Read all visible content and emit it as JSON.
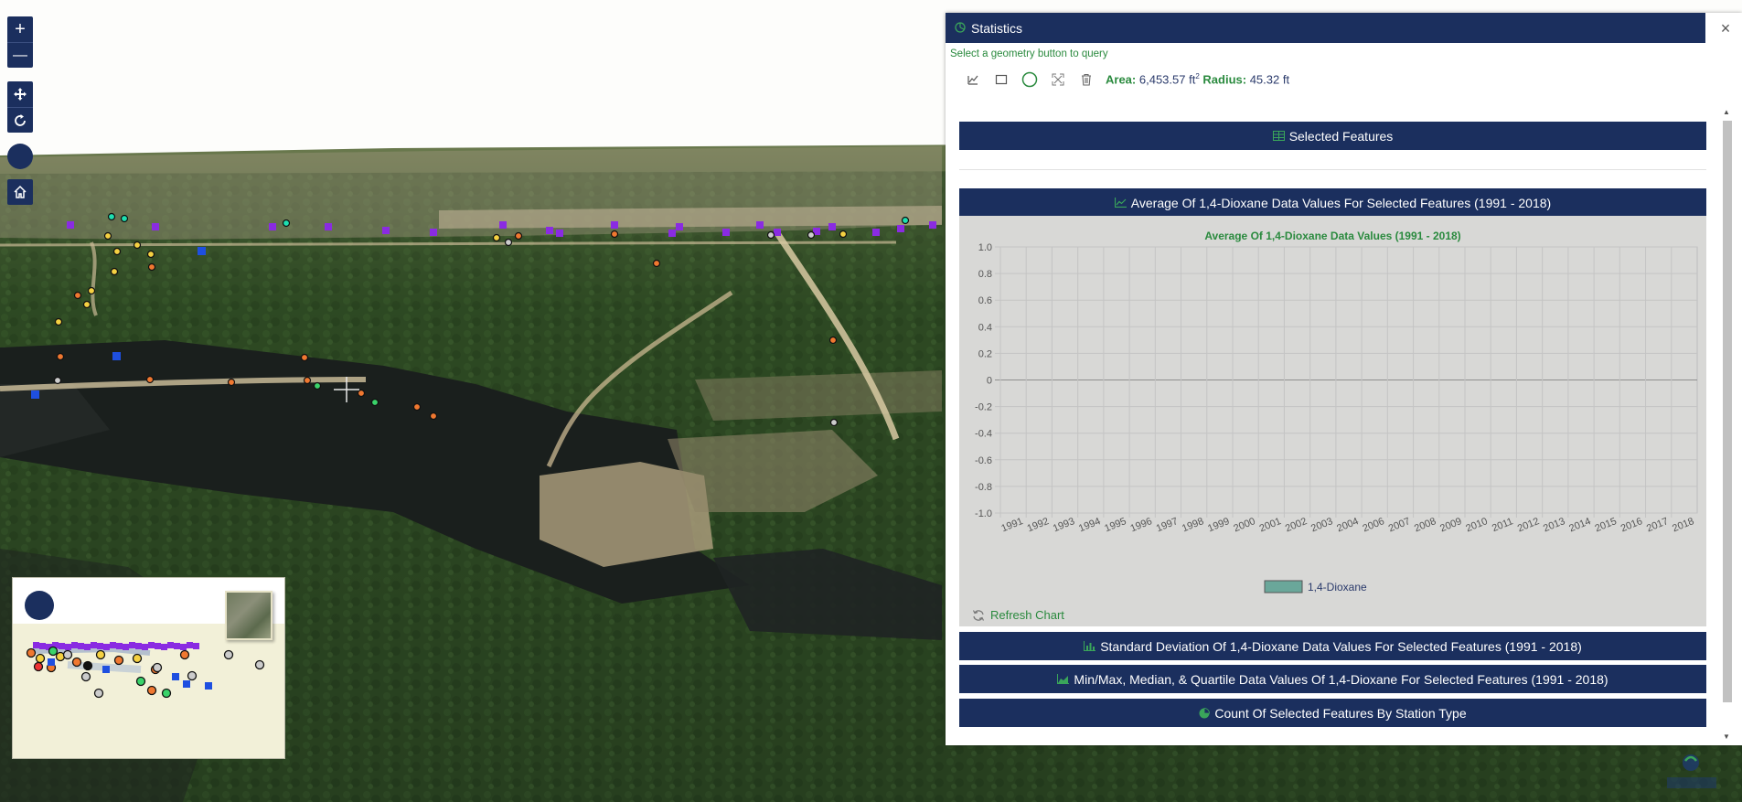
{
  "map": {
    "zoom_in_label": "+",
    "zoom_out_label": "—"
  },
  "panel": {
    "title": "Statistics",
    "close_label": "×",
    "hint": "Select a geometry button to query",
    "area_label": "Area:",
    "area_value": "6,453.57 ft",
    "area_unit_sup": "2",
    "radius_label": "Radius:",
    "radius_value": "45.32 ft"
  },
  "sections": {
    "selected_features": "Selected Features",
    "average": "Average Of 1,4-Dioxane Data Values For Selected Features (1991 - 2018)",
    "stddev": "Standard Deviation Of 1,4-Dioxane Data Values For Selected Features (1991 - 2018)",
    "minmax": "Min/Max, Median, & Quartile Data Values Of 1,4-Dioxane For Selected Features (1991 - 2018)",
    "count": "Count Of Selected Features By Station Type"
  },
  "refresh_label": "Refresh Chart",
  "colors": {
    "panel_navy": "#1b2f5e",
    "accent_green": "#2a8a3e",
    "series_fill": "#6aa79a"
  },
  "chart_data": {
    "type": "bar",
    "title": "Average Of 1,4-Dioxane Data Values (1991 - 2018)",
    "categories": [
      "1991",
      "1992",
      "1993",
      "1994",
      "1995",
      "1996",
      "1997",
      "1998",
      "1999",
      "2000",
      "2001",
      "2002",
      "2003",
      "2004",
      "2006",
      "2007",
      "2008",
      "2009",
      "2010",
      "2011",
      "2012",
      "2013",
      "2014",
      "2015",
      "2016",
      "2017",
      "2018"
    ],
    "series": [
      {
        "name": "1,4-Dioxane",
        "values": []
      }
    ],
    "yticks": [
      "1.0",
      "0.8",
      "0.6",
      "0.4",
      "0.2",
      "0",
      "-0.2",
      "-0.4",
      "-0.6",
      "-0.8",
      "-1.0"
    ],
    "ylim": [
      -1.0,
      1.0
    ],
    "grid": true,
    "legend": "bottom"
  }
}
